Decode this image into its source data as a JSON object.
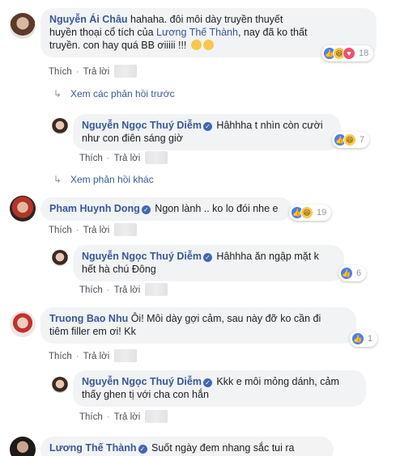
{
  "colors": {
    "link": "#385898",
    "bubble": "#f2f3f5",
    "muted": "#90949c",
    "like": "#4a7df2",
    "haha": "#f7c84d",
    "love": "#f0506e"
  },
  "actions": {
    "like": "Thích",
    "reply": "Trả lời",
    "dot": "·"
  },
  "c1": {
    "author": "Nguyễn Ái Châu",
    "line1": " hahaha. đôi môi dày truyền thuyết",
    "line2a": "huyền thoại cổ tích của ",
    "mention": "Lương Thế Thành",
    "line2b": ", nay đã ko thất",
    "line3": "truyền. con hay quá BB ơiiiii !!! ",
    "reactions": "18"
  },
  "more1": "Xem các phản hồi trước",
  "r1": {
    "author": "Nguyễn Ngọc Thuý Diễm",
    "line1": " Hâhhha t nhìn còn cười",
    "line2": "như con điên sáng giờ",
    "reactions": "7"
  },
  "more2": "Xem phản hồi khác",
  "c2": {
    "author": "Pham Huynh Dong",
    "text": " Ngon lành .. ko lo đói nhe e",
    "reactions": "19"
  },
  "r2": {
    "author": "Nguyễn Ngọc Thuý Diễm",
    "line1": " Hâhhha ăn ngập mặt k",
    "line2": "hết hà chú Đông",
    "reactions": "6"
  },
  "c3": {
    "author": "Truong Bao Nhu",
    "line1": " Ôi! Môi dày gợi cảm, sau này đỡ ko cần đi",
    "line2": "tiêm filler em ơi! Kk",
    "reactions": "1"
  },
  "r3": {
    "author": "Nguyễn Ngọc Thuý Diễm",
    "line1": " Kkk e môi mỏng dánh, cảm",
    "line2": "thấy ghen tị với cha con hắn"
  },
  "c4": {
    "author": "Lương Thế Thành",
    "text": " Suốt ngày đem nhang sắc tui ra"
  }
}
